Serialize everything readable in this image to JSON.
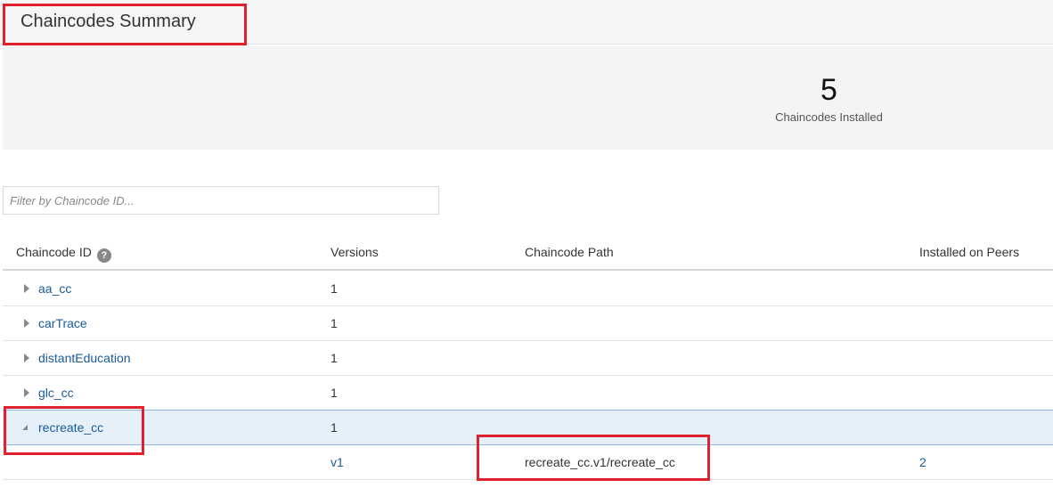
{
  "header": {
    "title": "Chaincodes Summary"
  },
  "summary": {
    "count": "5",
    "label": "Chaincodes Installed"
  },
  "filter": {
    "placeholder": "Filter by Chaincode ID...",
    "value": ""
  },
  "table": {
    "columns": {
      "id": "Chaincode ID",
      "versions": "Versions",
      "path": "Chaincode Path",
      "peers": "Installed on Peers"
    },
    "rows": [
      {
        "id": "aa_cc",
        "versions": "1"
      },
      {
        "id": "carTrace",
        "versions": "1"
      },
      {
        "id": "distantEducation",
        "versions": "1"
      },
      {
        "id": "glc_cc",
        "versions": "1"
      },
      {
        "id": "recreate_cc",
        "versions": "1",
        "expanded": true
      }
    ],
    "detail": {
      "version": "v1",
      "path": "recreate_cc.v1/recreate_cc",
      "peers": "2"
    }
  },
  "colors": {
    "highlight": "#e0202c",
    "link": "#1a5a99",
    "selected_row": "#e5f0f9"
  },
  "icons": {
    "help": "question-circle-icon",
    "row_toggle": "caret-right-icon"
  }
}
